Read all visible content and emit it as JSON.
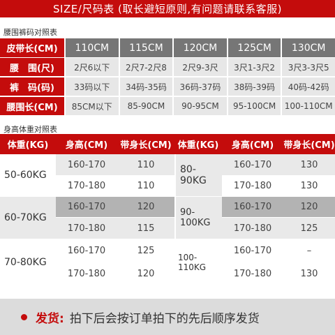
{
  "title": "SIZE/尺码表 (取长避短原则,有问题请联系客服)",
  "waist_section_label": "腰围裤码对照表",
  "waist_table": {
    "rows": [
      {
        "label": "皮带长(CM)",
        "cells": [
          "110CM",
          "115CM",
          "120CM",
          "125CM",
          "130CM"
        ]
      },
      {
        "label": "腰　围(尺)",
        "cells": [
          "2尺6以下",
          "2尺7-2尺8",
          "2尺9-3尺",
          "3尺1-3尺2",
          "3尺3-3尺5"
        ]
      },
      {
        "label": "裤　码(码)",
        "cells": [
          "33码以下",
          "34码-35码",
          "36码-37码",
          "38码-39码",
          "40码-42码"
        ]
      },
      {
        "label": "腰围长(CM)",
        "cells": [
          "85CM以下",
          "85-90CM",
          "90-95CM",
          "95-100CM",
          "100-110CM"
        ]
      }
    ]
  },
  "body_section_label": "身高体重对照表",
  "body_table": {
    "headers": [
      "体重(KG)",
      "身高(CM)",
      "带身长(CM)",
      "体重(KG)",
      "身高(CM)",
      "带身长(CM)"
    ],
    "left_groups": [
      {
        "weight": "50-60KG",
        "rows": [
          {
            "height": "160-170",
            "length": "110"
          },
          {
            "height": "170-180",
            "length": "110"
          }
        ]
      },
      {
        "weight": "60-70KG",
        "rows": [
          {
            "height": "160-170",
            "length": "120"
          },
          {
            "height": "170-180",
            "length": "115"
          }
        ]
      },
      {
        "weight": "70-80KG",
        "rows": [
          {
            "height": "160-170",
            "length": "125"
          },
          {
            "height": "170-180",
            "length": "120"
          }
        ]
      }
    ],
    "right_groups": [
      {
        "weight": "80-90KG",
        "rows": [
          {
            "height": "160-170",
            "length": "130"
          },
          {
            "height": "170-180",
            "length": "130"
          }
        ]
      },
      {
        "weight": "90-100KG",
        "rows": [
          {
            "height": "160-170",
            "length": "120"
          },
          {
            "height": "170-180",
            "length": "125"
          }
        ]
      },
      {
        "weight": "100-110KG",
        "rows": [
          {
            "height": "160-170",
            "length": "–"
          },
          {
            "height": "170-180",
            "length": "130"
          }
        ]
      }
    ]
  },
  "footer": {
    "label": "发货:",
    "text": "拍下后会按订单拍下的先后顺序发货"
  },
  "colors": {
    "accent": "#c40c0c",
    "header_gray": "#767676",
    "row_gray": "#b3b3b3",
    "row_light": "#e9e9e9"
  }
}
